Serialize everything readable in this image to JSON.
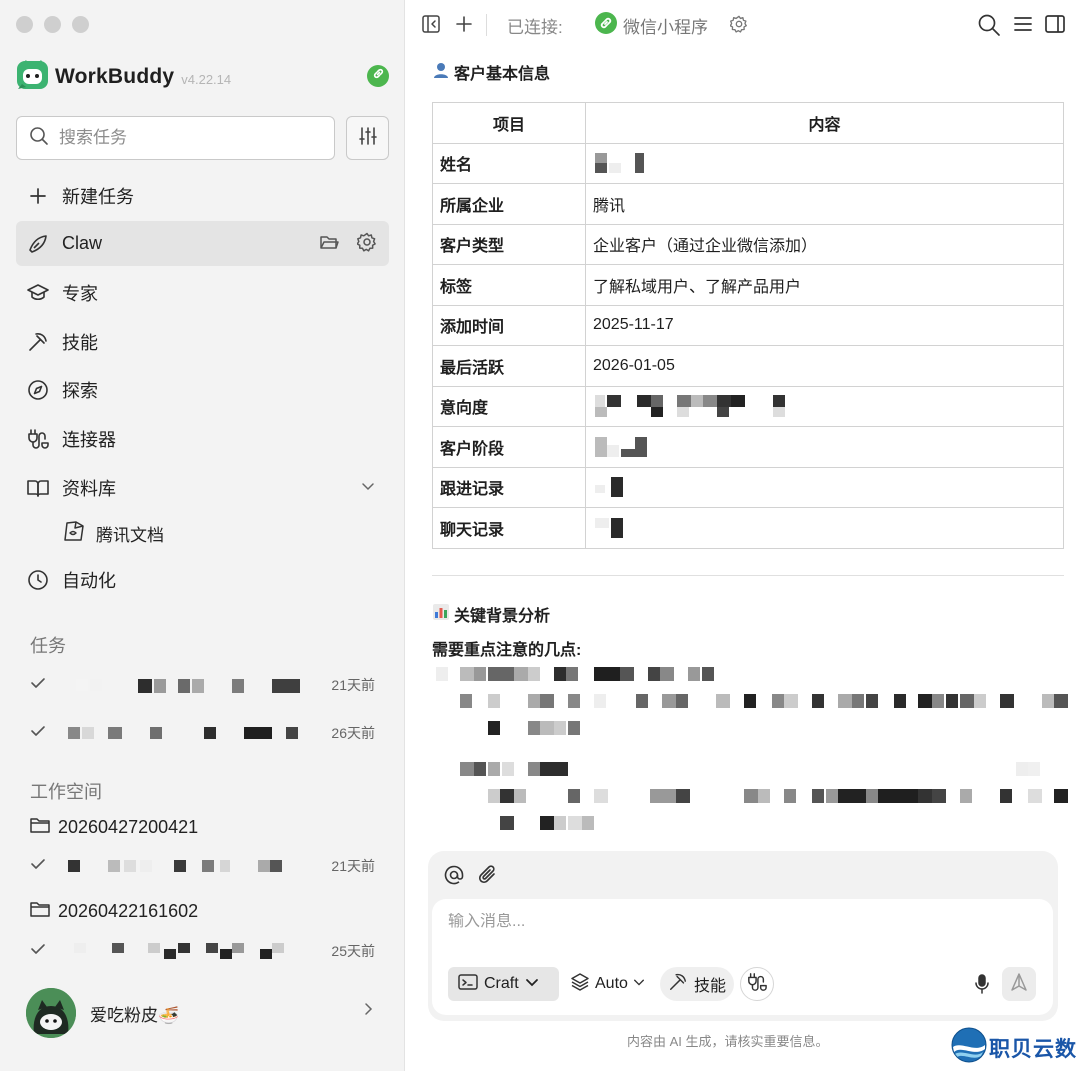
{
  "sidebar": {
    "brand": {
      "name": "WorkBuddy",
      "version": "v4.22.14"
    },
    "search": {
      "placeholder": "搜索任务"
    },
    "nav": {
      "new_task": "新建任务",
      "claw": "Claw",
      "expert": "专家",
      "skills": "技能",
      "explore": "探索",
      "connectors": "连接器",
      "library": "资料库",
      "library_sub": "腾讯文档",
      "automation": "自动化"
    },
    "tasks_title": "任务",
    "tasks": [
      {
        "time": "21天前"
      },
      {
        "time": "26天前"
      }
    ],
    "workspace_title": "工作空间",
    "workspaces": [
      {
        "name": "20260427200421",
        "task_time": "21天前"
      },
      {
        "name": "20260422161602",
        "task_time": "25天前"
      }
    ],
    "user": {
      "name": "爱吃粉皮🍜"
    }
  },
  "topbar": {
    "connected_label": "已连接:",
    "connected_app": "微信小程序"
  },
  "main": {
    "customer_section": "客户基本信息",
    "table": {
      "headers": [
        "项目",
        "内容"
      ],
      "rows": [
        {
          "key": "姓名",
          "value": ""
        },
        {
          "key": "所属企业",
          "value": "腾讯"
        },
        {
          "key": "客户类型",
          "value": "企业客户（通过企业微信添加）"
        },
        {
          "key": "标签",
          "value": "了解私域用户、了解产品用户"
        },
        {
          "key": "添加时间",
          "value": "2025-11-17"
        },
        {
          "key": "最后活跃",
          "value": "2026-01-05"
        },
        {
          "key": "意向度",
          "value": ""
        },
        {
          "key": "客户阶段",
          "value": ""
        },
        {
          "key": "跟进记录",
          "value": ""
        },
        {
          "key": "聊天记录",
          "value": ""
        }
      ]
    },
    "analysis_section": "关键背景分析",
    "attention_note": "需要重点注意的几点:"
  },
  "composer": {
    "placeholder": "输入消息...",
    "mode": "Craft",
    "model": "Auto",
    "skills": "技能"
  },
  "footer": {
    "disclaimer": "内容由 AI 生成，请核实重要信息。",
    "watermark": "职贝云数"
  },
  "colors": {
    "accent_green": "#4cb64e",
    "sidebar_bg": "#f3f3f3",
    "watermark_blue": "#1a56a8"
  }
}
